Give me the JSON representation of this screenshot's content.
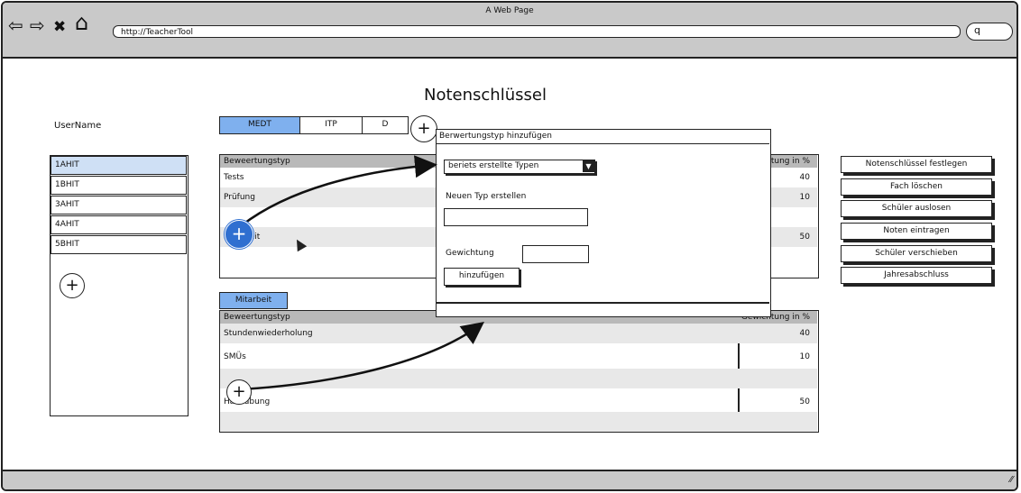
{
  "window": {
    "title": "A Web Page",
    "url": "http://TeacherTool"
  },
  "nav": {
    "back": "⇦",
    "forward": "⇨",
    "stop": "✖",
    "home": "⌂",
    "search_glyph": "q"
  },
  "page": {
    "title": "Notenschlüssel",
    "username": "UserName"
  },
  "classes": [
    "1AHIT",
    "1BHIT",
    "3AHIT",
    "4AHIT",
    "5BHIT"
  ],
  "selected_class": "1AHIT",
  "subject_tabs": [
    "MEDT",
    "ITP",
    "D"
  ],
  "active_tab": "MEDT",
  "plus": "+",
  "table1": {
    "header_type": "Beweertungstyp",
    "header_weight": "Gewichtung in %",
    "rows": [
      {
        "type": "Tests",
        "weight": "40"
      },
      {
        "type": "Prüfung",
        "weight": "10"
      },
      {
        "type": "",
        "weight": ""
      },
      {
        "type": "Mitarbeit",
        "weight": "50"
      },
      {
        "type": "",
        "weight": ""
      }
    ]
  },
  "table2": {
    "tab": "Mitarbeit",
    "header_type": "Beweertungstyp",
    "header_weight": "Gewichtung in %",
    "rows": [
      {
        "type": "Stundenwiederholung",
        "weight": "40"
      },
      {
        "type": "SMÜs",
        "weight": "10"
      },
      {
        "type": "",
        "weight": ""
      },
      {
        "type": "Hausübung",
        "weight": "50"
      },
      {
        "type": "",
        "weight": ""
      }
    ]
  },
  "dialog": {
    "title": "Berwertungstyp hinzufügen",
    "select_value": "beriets erstellte Typen",
    "new_type_label": "Neuen Typ erstellen",
    "weight_label": "Gewichtung",
    "add_button": "hinzufügen"
  },
  "actions": [
    "Notenschlüssel festlegen",
    "Fach löschen",
    "Schüler auslosen",
    "Noten eintragen",
    "Schüler verschieben",
    "Jahresabschluss"
  ],
  "colors": {
    "accent_tab": "#7fb0ee",
    "selected_row": "#cfe0f5",
    "plus_circle": "#2f6fd0",
    "chrome": "#c9c9c9"
  }
}
